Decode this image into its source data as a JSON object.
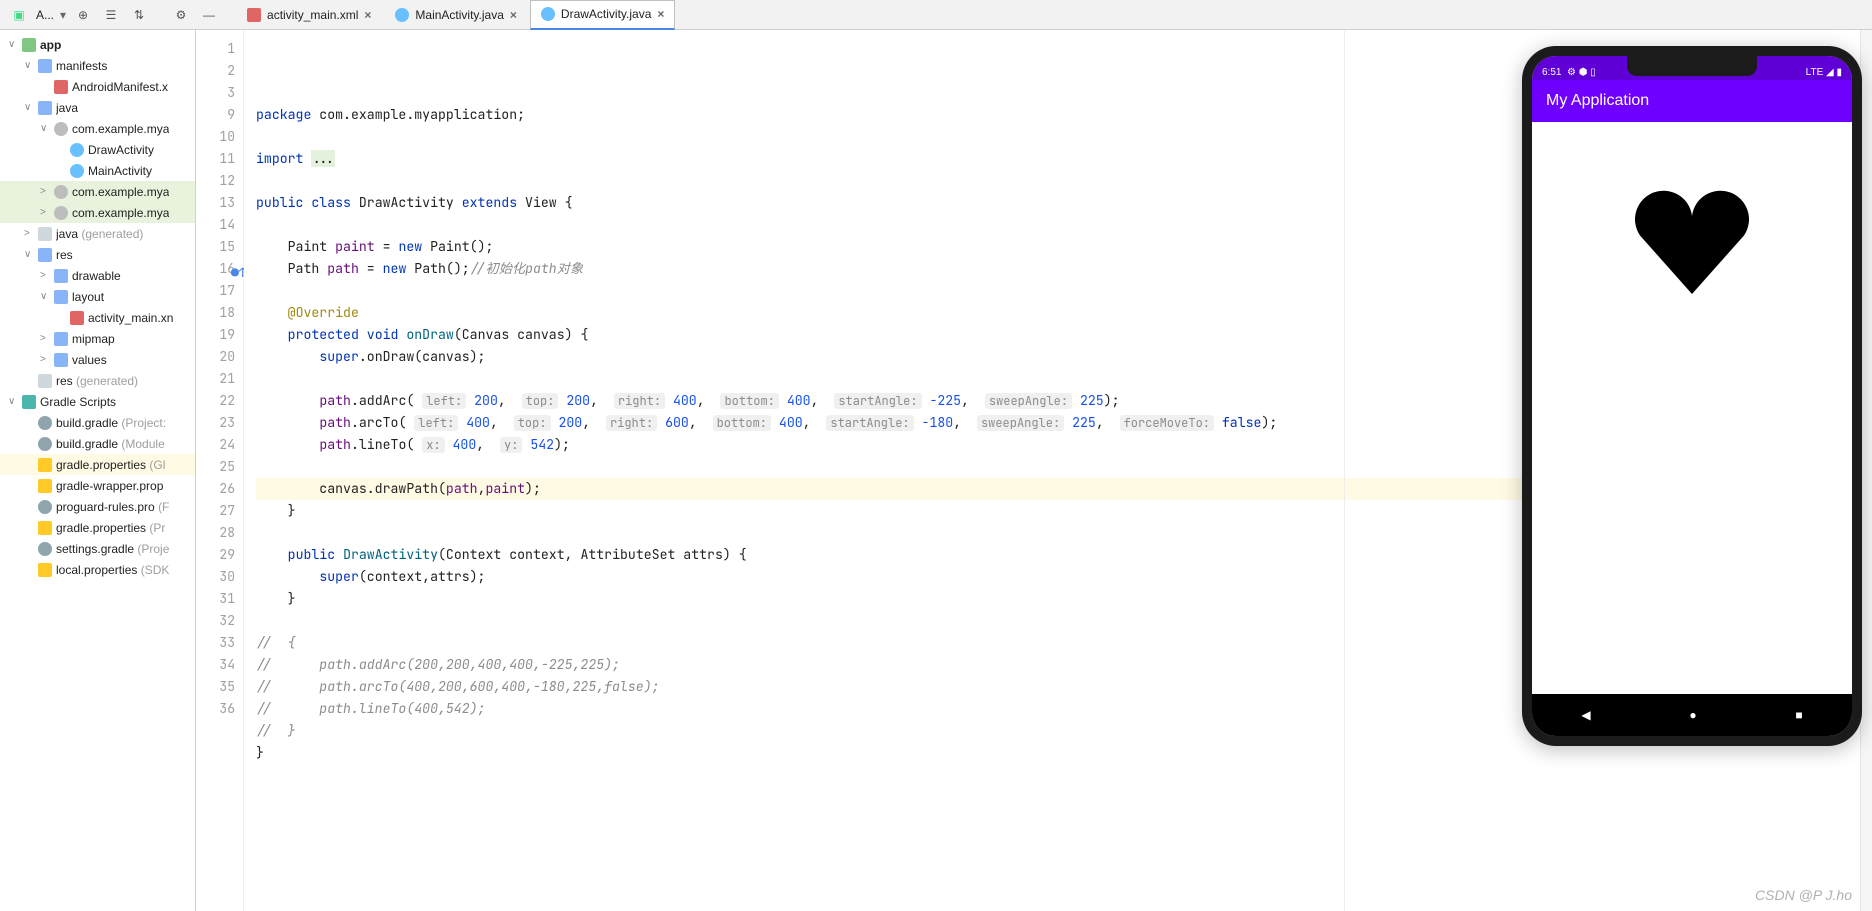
{
  "toolbar": {
    "view_label": "A..."
  },
  "tabs": [
    {
      "label": "activity_main.xml",
      "icon": "xml",
      "active": false
    },
    {
      "label": "MainActivity.java",
      "icon": "java",
      "active": false
    },
    {
      "label": "DrawActivity.java",
      "icon": "java",
      "active": true
    }
  ],
  "project_tree": [
    {
      "indent": 0,
      "chev": "∨",
      "icon": "module",
      "label": "app",
      "bold": true
    },
    {
      "indent": 1,
      "chev": "∨",
      "icon": "folder",
      "label": "manifests"
    },
    {
      "indent": 2,
      "chev": "",
      "icon": "xmlf",
      "label": "AndroidManifest.x"
    },
    {
      "indent": 1,
      "chev": "∨",
      "icon": "folder",
      "label": "java"
    },
    {
      "indent": 2,
      "chev": "∨",
      "icon": "pkg",
      "label": "com.example.mya"
    },
    {
      "indent": 3,
      "chev": "",
      "icon": "javaf",
      "label": "DrawActivity"
    },
    {
      "indent": 3,
      "chev": "",
      "icon": "javaf",
      "label": "MainActivity"
    },
    {
      "indent": 2,
      "chev": ">",
      "icon": "pkg",
      "label": "com.example.mya",
      "hl": true
    },
    {
      "indent": 2,
      "chev": ">",
      "icon": "pkg",
      "label": "com.example.mya",
      "hl": true
    },
    {
      "indent": 1,
      "chev": ">",
      "icon": "folder-gen",
      "label": "java",
      "suffix": "(generated)"
    },
    {
      "indent": 1,
      "chev": "∨",
      "icon": "folder",
      "label": "res"
    },
    {
      "indent": 2,
      "chev": ">",
      "icon": "folder",
      "label": "drawable"
    },
    {
      "indent": 2,
      "chev": "∨",
      "icon": "folder",
      "label": "layout"
    },
    {
      "indent": 3,
      "chev": "",
      "icon": "xmlf",
      "label": "activity_main.xn"
    },
    {
      "indent": 2,
      "chev": ">",
      "icon": "folder",
      "label": "mipmap"
    },
    {
      "indent": 2,
      "chev": ">",
      "icon": "folder",
      "label": "values"
    },
    {
      "indent": 1,
      "chev": "",
      "icon": "folder-gen",
      "label": "res",
      "suffix": "(generated)"
    },
    {
      "indent": 0,
      "chev": "∨",
      "icon": "gradle-el",
      "label": "Gradle Scripts"
    },
    {
      "indent": 1,
      "chev": "",
      "icon": "gradle",
      "label": "build.gradle",
      "suffix": "(Project:"
    },
    {
      "indent": 1,
      "chev": "",
      "icon": "gradle",
      "label": "build.gradle",
      "suffix": "(Module"
    },
    {
      "indent": 1,
      "chev": "",
      "icon": "props",
      "label": "gradle.properties",
      "suffix": "(Gl",
      "sel": true
    },
    {
      "indent": 1,
      "chev": "",
      "icon": "props",
      "label": "gradle-wrapper.prop"
    },
    {
      "indent": 1,
      "chev": "",
      "icon": "gradle",
      "label": "proguard-rules.pro",
      "suffix": "(F"
    },
    {
      "indent": 1,
      "chev": "",
      "icon": "props",
      "label": "gradle.properties",
      "suffix": "(Pr"
    },
    {
      "indent": 1,
      "chev": "",
      "icon": "gradle",
      "label": "settings.gradle",
      "suffix": "(Proje"
    },
    {
      "indent": 1,
      "chev": "",
      "icon": "props",
      "label": "local.properties",
      "suffix": "(SDK"
    }
  ],
  "code_lines": [
    {
      "n": 1,
      "html": "<span class='kw'>package</span> com.example.myapplication;"
    },
    {
      "n": 2,
      "html": ""
    },
    {
      "n": 3,
      "html": "<span class='kw'>import</span> <span style='background:#e4f1dd'>...</span>"
    },
    {
      "n": 9,
      "html": ""
    },
    {
      "n": 10,
      "html": "<span class='kw'>public class</span> DrawActivity <span class='kw'>extends</span> View {"
    },
    {
      "n": 11,
      "html": ""
    },
    {
      "n": 12,
      "html": "    Paint <span class='field'>paint</span> = <span class='kw'>new</span> Paint();"
    },
    {
      "n": 13,
      "html": "    Path <span class='field'>path</span> = <span class='kw'>new</span> Path();<span class='cmt'>//初始化path对象</span>"
    },
    {
      "n": 14,
      "html": ""
    },
    {
      "n": 15,
      "html": "    <span class='ann'>@Override</span>"
    },
    {
      "n": 16,
      "html": "    <span class='kw'>protected void</span> <span class='method'>onDraw</span>(Canvas canvas) {",
      "mark": "override"
    },
    {
      "n": 17,
      "html": "        <span class='kw'>super</span>.onDraw(canvas);"
    },
    {
      "n": 18,
      "html": ""
    },
    {
      "n": 19,
      "html": "        <span class='field'>path</span>.addArc( <span class='hint'>left:</span> <span class='num'>200</span>,  <span class='hint'>top:</span> <span class='num'>200</span>,  <span class='hint'>right:</span> <span class='num'>400</span>,  <span class='hint'>bottom:</span> <span class='num'>400</span>,  <span class='hint'>startAngle:</span> <span class='num'>-225</span>,  <span class='hint'>sweepAngle:</span> <span class='num'>225</span>);"
    },
    {
      "n": 20,
      "html": "        <span class='field'>path</span>.arcTo( <span class='hint'>left:</span> <span class='num'>400</span>,  <span class='hint'>top:</span> <span class='num'>200</span>,  <span class='hint'>right:</span> <span class='num'>600</span>,  <span class='hint'>bottom:</span> <span class='num'>400</span>,  <span class='hint'>startAngle:</span> <span class='num'>-180</span>,  <span class='hint'>sweepAngle:</span> <span class='num'>225</span>,  <span class='hint'>forceMoveTo:</span> <span class='kw'>false</span>);"
    },
    {
      "n": 21,
      "html": "        <span class='field'>path</span>.lineTo( <span class='hint'>x:</span> <span class='num'>400</span>,  <span class='hint'>y:</span> <span class='num'>542</span>);"
    },
    {
      "n": 22,
      "html": ""
    },
    {
      "n": 23,
      "html": "        canvas.drawPath(<span class='field'>path</span>,<span class='field'>paint</span>);",
      "current": true
    },
    {
      "n": 24,
      "html": "    }"
    },
    {
      "n": 25,
      "html": ""
    },
    {
      "n": 26,
      "html": "    <span class='kw'>public</span> <span class='method'>DrawActivity</span>(Context context, AttributeSet attrs) {"
    },
    {
      "n": 27,
      "html": "        <span class='kw'>super</span>(context,attrs);"
    },
    {
      "n": 28,
      "html": "    }"
    },
    {
      "n": 29,
      "html": ""
    },
    {
      "n": 30,
      "html": "<span class='cmt'>//  {</span>"
    },
    {
      "n": 31,
      "html": "<span class='cmt'>//      path.addArc(200,200,400,400,-225,225);</span>"
    },
    {
      "n": 32,
      "html": "<span class='cmt'>//      path.arcTo(400,200,600,400,-180,225,false);</span>"
    },
    {
      "n": 33,
      "html": "<span class='cmt'>//      path.lineTo(400,542);</span>"
    },
    {
      "n": 34,
      "html": "<span class='cmt'>//  }</span>"
    },
    {
      "n": 35,
      "html": "}"
    },
    {
      "n": 36,
      "html": ""
    }
  ],
  "emulator": {
    "status_time": "6:51",
    "status_right": "LTE ◢ ▮",
    "app_title": "My Application"
  },
  "watermark": "CSDN @P J.ho"
}
